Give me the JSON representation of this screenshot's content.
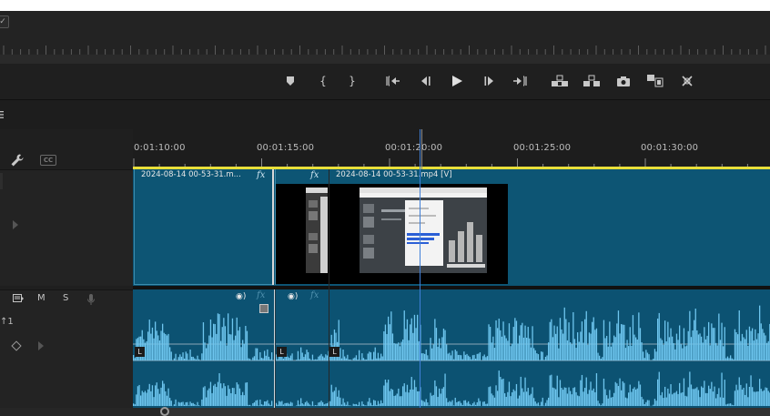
{
  "monitor": {
    "dropdown_icon": "chevron-down-icon"
  },
  "transport": {
    "buttons": [
      {
        "name": "add-marker-button",
        "icon": "marker-icon"
      },
      {
        "name": "mark-in-button",
        "icon": "bracket-open-icon",
        "glyph": "{"
      },
      {
        "name": "mark-out-button",
        "icon": "bracket-close-icon",
        "glyph": "}"
      },
      {
        "name": "go-to-in-button",
        "icon": "go-to-in-icon"
      },
      {
        "name": "step-back-button",
        "icon": "step-back-icon"
      },
      {
        "name": "play-button",
        "icon": "play-icon"
      },
      {
        "name": "step-forward-button",
        "icon": "step-forward-icon"
      },
      {
        "name": "go-to-out-button",
        "icon": "go-to-out-icon"
      },
      {
        "name": "lift-button",
        "icon": "lift-icon"
      },
      {
        "name": "extract-button",
        "icon": "extract-icon"
      },
      {
        "name": "export-frame-button",
        "icon": "camera-icon"
      },
      {
        "name": "comparison-view-button",
        "icon": "compare-icon"
      },
      {
        "name": "settings-button",
        "icon": "wrench-extras-icon"
      }
    ]
  },
  "timeline": {
    "menu_icon": "hamburger-icon",
    "tools": {
      "wrench_icon": "wrench-icon",
      "cc_label": "CC"
    },
    "ruler": {
      "timecodes": [
        "0:01:10:00",
        "00:01:15:00",
        "00:01:20:00",
        "00:01:25:00",
        "00:01:30:00"
      ]
    },
    "video_track": {
      "clips": [
        {
          "label": "2024-08-14 00-53-31.m...",
          "fx": "fx"
        },
        {
          "label": "2024-08-14 00-53-31.mp4 [V]",
          "fx": "fx"
        }
      ]
    },
    "audio_track": {
      "buttons": {
        "mute": "M",
        "solo": "S"
      },
      "label": "1",
      "channel_marks": [
        "L",
        "L",
        "L"
      ],
      "fx": [
        "fx",
        "fx"
      ]
    }
  },
  "colors": {
    "clip": "#0c5272",
    "clip_border": "#3a8cad",
    "waveform": "#6ec6ef",
    "work_area": "#e8df3a",
    "playhead": "#3f7fd8"
  }
}
